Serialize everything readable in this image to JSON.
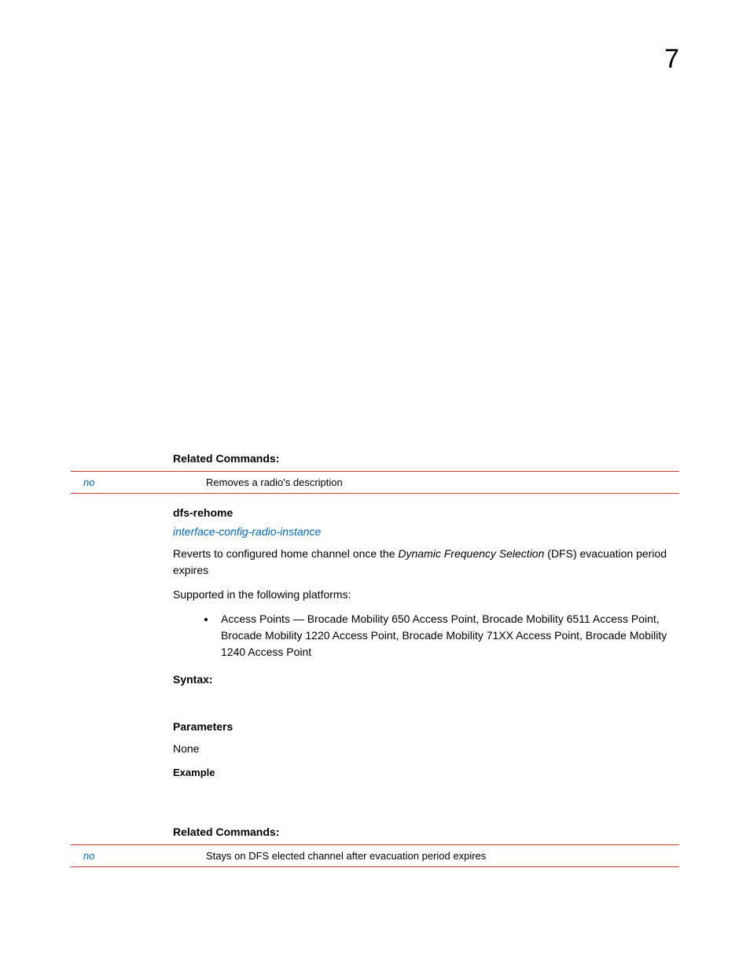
{
  "pageNumber": "7",
  "section1": {
    "relatedHeading": "Related Commands:",
    "cmd": "no",
    "cmdDesc": "Removes a radio's description"
  },
  "dfs": {
    "title": "dfs-rehome",
    "linkText": "interface-config-radio-instance",
    "desc_pre": "Reverts to configured home channel once the ",
    "desc_em": "Dynamic Frequency Selection",
    "desc_post": " (DFS) evacuation period expires",
    "supported": "Supported in the following platforms:",
    "bullet": "Access Points — Brocade Mobility 650 Access Point, Brocade Mobility 6511 Access Point, Brocade Mobility 1220 Access Point, Brocade Mobility 71XX Access Point, Brocade Mobility 1240 Access Point",
    "syntax": "Syntax:",
    "parameters": "Parameters",
    "none": "None",
    "example": "Example",
    "relatedHeading": "Related Commands:",
    "cmd": "no",
    "cmdDesc": "Stays on DFS elected channel after evacuation period expires"
  }
}
